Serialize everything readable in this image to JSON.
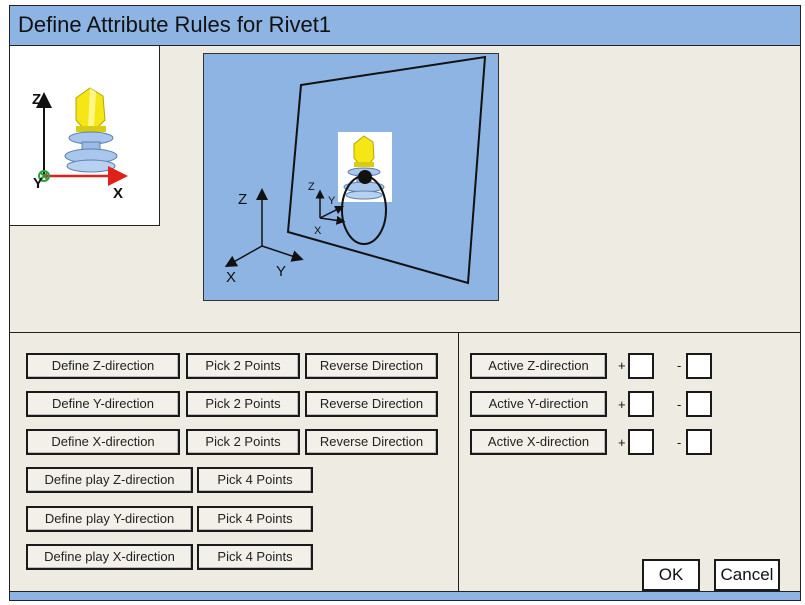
{
  "window": {
    "title": "Define Attribute Rules for Rivet1"
  },
  "thumbnail": {
    "axis_z": "Z",
    "axis_y": "Y",
    "axis_x": "X"
  },
  "viewport": {
    "global_axis_z": "Z",
    "global_axis_y": "Y",
    "global_axis_x": "X",
    "local_axis_z": "Z",
    "local_axis_y": "Y",
    "local_axis_x": "X"
  },
  "define_rows": [
    {
      "define": "Define Z-direction",
      "pick": "Pick 2 Points",
      "reverse": "Reverse Direction"
    },
    {
      "define": "Define Y-direction",
      "pick": "Pick 2 Points",
      "reverse": "Reverse Direction"
    },
    {
      "define": "Define X-direction",
      "pick": "Pick 2 Points",
      "reverse": "Reverse Direction"
    }
  ],
  "play_rows": [
    {
      "define": "Define play Z-direction",
      "pick": "Pick 4 Points"
    },
    {
      "define": "Define play Y-direction",
      "pick": "Pick 4 Points"
    },
    {
      "define": "Define play X-direction",
      "pick": "Pick 4 Points"
    }
  ],
  "active_rows": [
    {
      "label": "Active Z-direction",
      "plus": "+",
      "minus": "-"
    },
    {
      "label": "Active Y-direction",
      "plus": "+",
      "minus": "-"
    },
    {
      "label": "Active X-direction",
      "plus": "+",
      "minus": "-"
    }
  ],
  "actions": {
    "ok": "OK",
    "cancel": "Cancel"
  },
  "colors": {
    "titlebar": "#8db4e2",
    "viewport": "#8db4e2",
    "panel": "#eeece2",
    "rivet_head": "#f5e616",
    "rivet_body": "#a9c6ec",
    "axis_x": "#e0201a",
    "axis_y_marker": "#2e9e3c"
  }
}
